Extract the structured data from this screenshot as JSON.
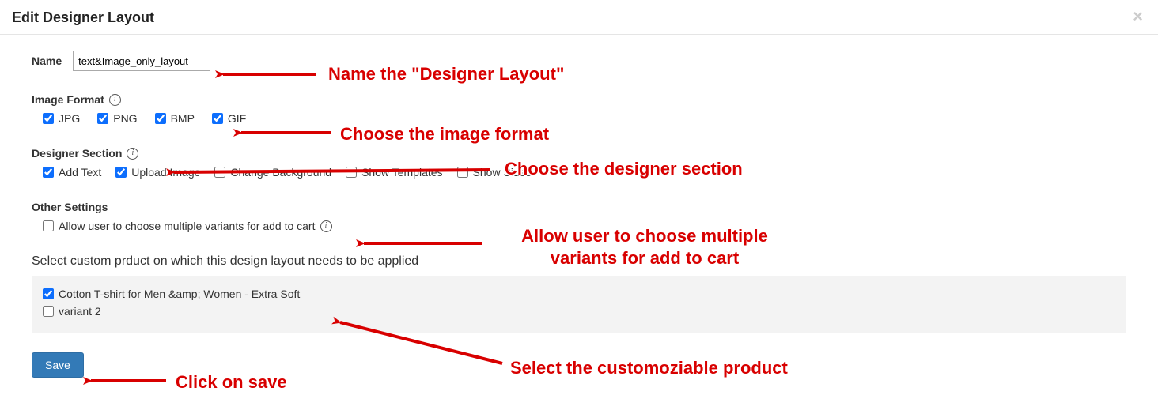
{
  "header": {
    "title": "Edit Designer Layout",
    "close_symbol": "×"
  },
  "name_field": {
    "label": "Name",
    "value": "text&Image_only_layout"
  },
  "image_format": {
    "heading": "Image Format",
    "options": [
      {
        "label": "JPG",
        "checked": true
      },
      {
        "label": "PNG",
        "checked": true
      },
      {
        "label": "BMP",
        "checked": true
      },
      {
        "label": "GIF",
        "checked": true
      }
    ]
  },
  "designer_section": {
    "heading": "Designer Section",
    "options": [
      {
        "label": "Add Text",
        "checked": true
      },
      {
        "label": "Upload Image",
        "checked": true
      },
      {
        "label": "Change Background",
        "checked": false
      },
      {
        "label": "Show Templates",
        "checked": false
      },
      {
        "label": "Show Sides",
        "checked": false
      }
    ]
  },
  "other_settings": {
    "heading": "Other Settings",
    "option_label": "Allow user to choose multiple variants for add to cart",
    "checked": false
  },
  "product_select": {
    "heading": "Select custom prduct on which this design layout needs to be applied",
    "items": [
      {
        "label": "Cotton T-shirt for Men &amp; Women - Extra Soft",
        "checked": true
      },
      {
        "label": "variant 2",
        "checked": false
      }
    ]
  },
  "buttons": {
    "save": "Save"
  },
  "annotations": {
    "a1": "Name the \"Designer Layout\"",
    "a2": "Choose the image format",
    "a3": "Choose the designer section",
    "a4": "Allow user to choose\nmultiple variants for add to cart",
    "a5": "Select the customoziable product",
    "a6": "Click on save"
  }
}
